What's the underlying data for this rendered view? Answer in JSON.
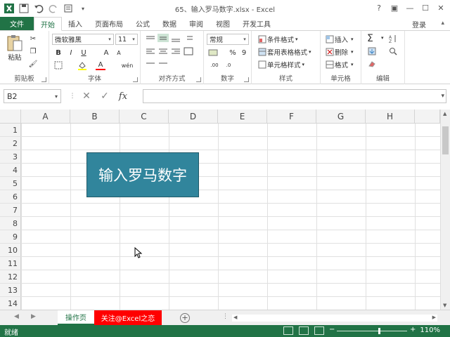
{
  "window": {
    "title": "65、输入罗马数字.xlsx - Excel",
    "controls": [
      "?",
      "▣",
      "—",
      "☐",
      "✕"
    ]
  },
  "tabs": [
    {
      "label": "文件"
    },
    {
      "label": "开始"
    },
    {
      "label": "插入"
    },
    {
      "label": "页面布局"
    },
    {
      "label": "公式"
    },
    {
      "label": "数据"
    },
    {
      "label": "审阅"
    },
    {
      "label": "视图"
    },
    {
      "label": "开发工具"
    }
  ],
  "account": {
    "login": "登录"
  },
  "ribbon": {
    "clipboard": {
      "paste": "粘贴",
      "label": "剪贴板"
    },
    "font": {
      "name": "微软雅黑",
      "size": "11",
      "bold": "B",
      "italic": "I",
      "underline": "U",
      "grow": "A",
      "shrink": "A",
      "color_a": "A",
      "wen": "wén",
      "label": "字体"
    },
    "alignment": {
      "label": "对齐方式"
    },
    "number": {
      "format": "常规",
      "percent": "%",
      "comma": "9",
      "label": "数字"
    },
    "styles": {
      "conditional": "条件格式",
      "table": "套用表格格式",
      "cell": "单元格样式",
      "label": "样式"
    },
    "cells": {
      "insert": "插入",
      "delete": "删除",
      "format": "格式",
      "label": "单元格"
    },
    "editing": {
      "sigma": "Σ",
      "label": "编辑"
    }
  },
  "formula_bar": {
    "name_box": "B2",
    "cancel": "✕",
    "enter": "✓",
    "fx": "fx",
    "value": ""
  },
  "grid": {
    "columns": [
      "A",
      "B",
      "C",
      "D",
      "E",
      "F",
      "G",
      "H"
    ],
    "rows": [
      "1",
      "2",
      "3",
      "4",
      "5",
      "6",
      "7",
      "8",
      "9",
      "10",
      "11",
      "12",
      "13",
      "14"
    ]
  },
  "shape": {
    "text": "输入罗马数字",
    "fill": "#31859c"
  },
  "sheets": [
    {
      "label": "操作页"
    },
    {
      "label": "关注@Excel之恋"
    }
  ],
  "status": {
    "ready": "就绪",
    "zoom": "110%"
  },
  "colors": {
    "accent": "#217346",
    "sheet_red": "#ff0000"
  }
}
